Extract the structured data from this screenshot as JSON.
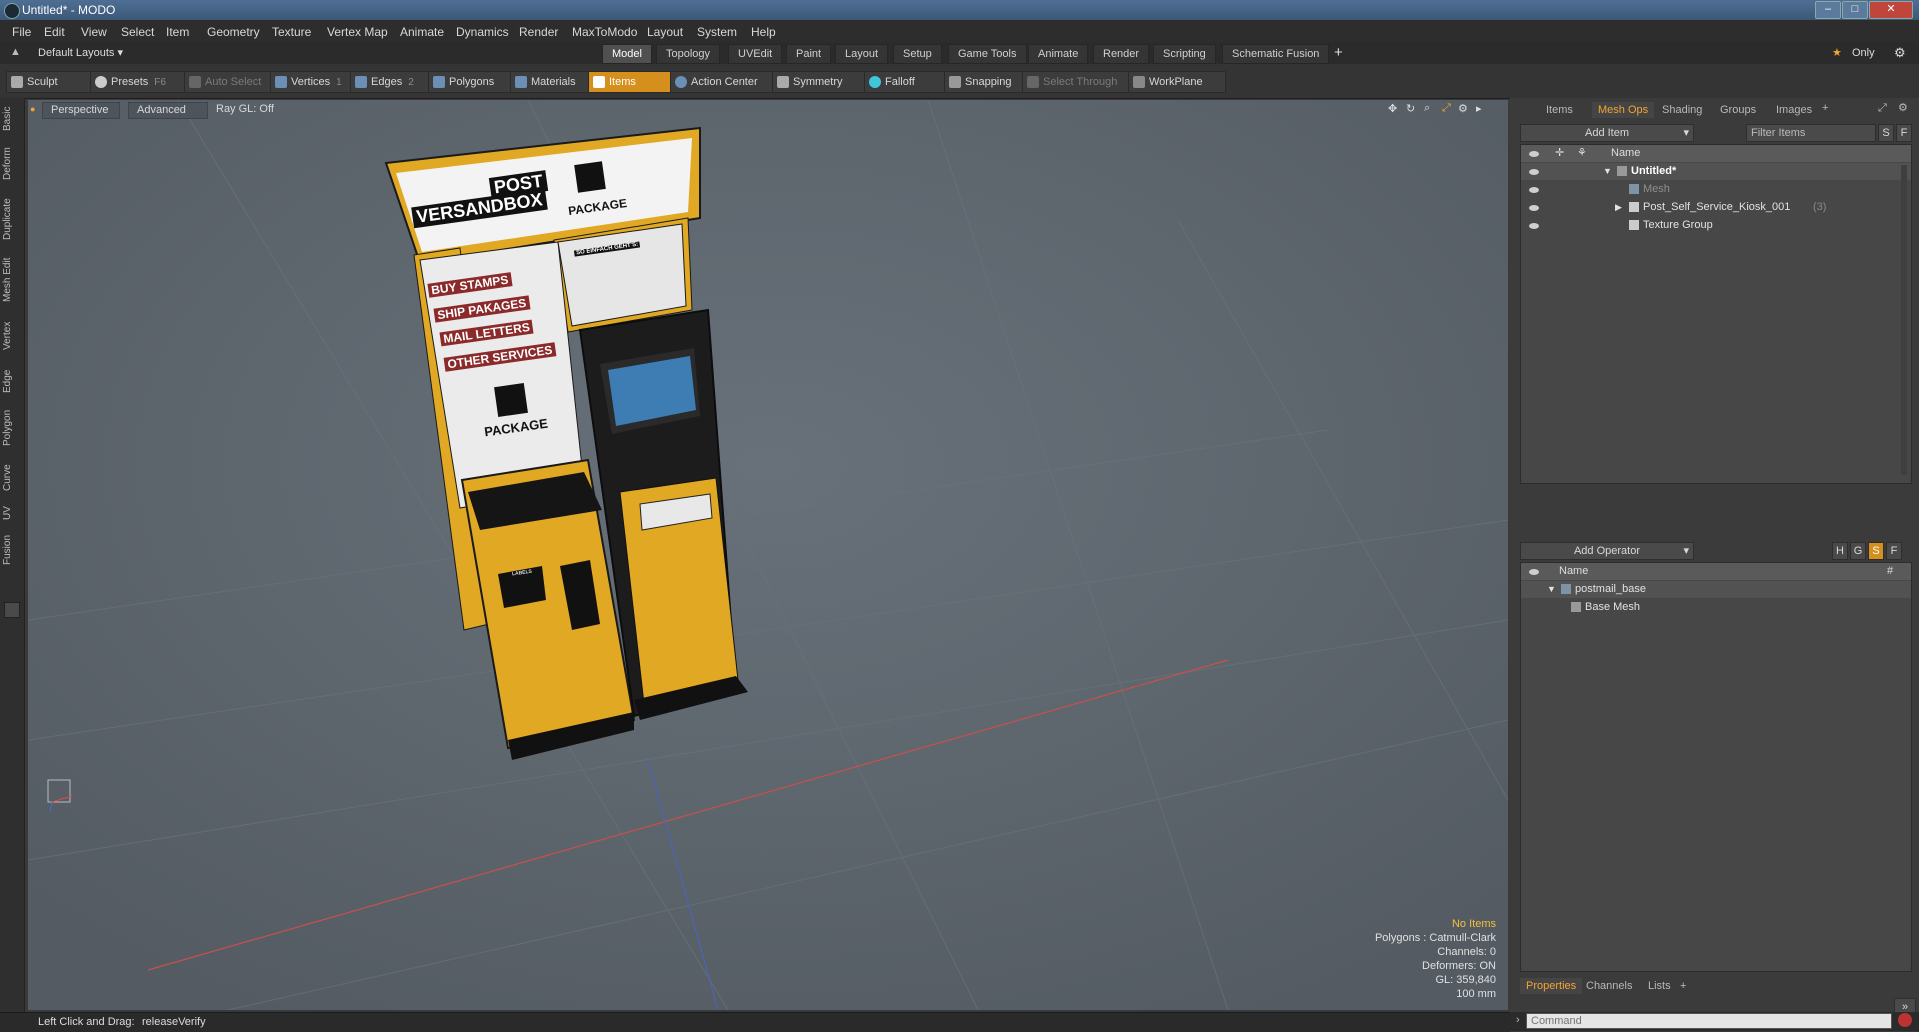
{
  "window": {
    "title": "Untitled* - MODO"
  },
  "menu": [
    "File",
    "Edit",
    "View",
    "Select",
    "Item",
    "Geometry",
    "Texture",
    "Vertex Map",
    "Animate",
    "Dynamics",
    "Render",
    "MaxToModo",
    "Layout",
    "System",
    "Help"
  ],
  "layout_bar": {
    "layouts_label": "Default Layouts",
    "tabs": [
      "Model",
      "Topology",
      "UVEdit",
      "Paint",
      "Layout",
      "Setup",
      "Game Tools",
      "Animate",
      "Render",
      "Scripting",
      "Schematic Fusion"
    ],
    "active_tab": "Model",
    "only_label": "Only"
  },
  "toolbar": {
    "sculpt": "Sculpt",
    "presets": "Presets",
    "presets_key": "F6",
    "auto_select": "Auto Select",
    "vertices": "Vertices",
    "vertices_key": "1",
    "edges": "Edges",
    "edges_key": "2",
    "polygons": "Polygons",
    "materials": "Materials",
    "items": "Items",
    "action_center": "Action Center",
    "symmetry": "Symmetry",
    "falloff": "Falloff",
    "snapping": "Snapping",
    "select_through": "Select Through",
    "workplane": "WorkPlane"
  },
  "left_tabs": [
    "Basic",
    "Deform",
    "Duplicate",
    "Mesh Edit",
    "Vertex",
    "Edge",
    "Polygon",
    "Curve",
    "UV",
    "Fusion"
  ],
  "viewport": {
    "perspective": "Perspective",
    "advanced": "Advanced",
    "raygl": "Ray GL: Off",
    "info": {
      "no_items": "No Items",
      "polygons": "Polygons : Catmull-Clark",
      "channels": "Channels: 0",
      "deformers": "Deformers: ON",
      "gl": "GL: 359,840",
      "scale": "100 mm"
    },
    "scene_text": {
      "post": "POST",
      "versandbox": "VERSANDBOX",
      "package_top": "PACKAGE",
      "buy_stamps": "BUY STAMPS",
      "ship_packages": "SHIP PAKAGES",
      "mail_letters": "MAIL LETTERS",
      "other_services": "OTHER SERVICES",
      "package_mid": "PACKAGE",
      "so_einfach": "SO EINFACH GEHT'S:",
      "labels": "LABELS"
    },
    "colors": {
      "kiosk_yellow": "#e0a823",
      "kiosk_black": "#1a1a1a",
      "viewport_bg": "#5d656c"
    }
  },
  "right_panel": {
    "tabs": [
      "Items",
      "Mesh Ops",
      "Shading",
      "Groups",
      "Images"
    ],
    "active_tab": "Mesh Ops",
    "add_item": "Add Item",
    "filter_items": "Filter Items",
    "name_col": "Name",
    "tree": [
      {
        "label": "Untitled*",
        "bold": true
      },
      {
        "label": "Mesh",
        "dim": true
      },
      {
        "label": "Post_Self_Service_Kiosk_001",
        "count": "(3)"
      },
      {
        "label": "Texture Group"
      }
    ],
    "add_operator": "Add Operator",
    "op_name_col": "Name",
    "op_hash_col": "#",
    "operators": [
      {
        "label": "postmail_base"
      },
      {
        "label": "Base Mesh"
      }
    ],
    "bottom_tabs": [
      "Properties",
      "Channels",
      "Lists"
    ],
    "bottom_active": "Properties",
    "command_placeholder": "Command",
    "accent": "#f3a531"
  },
  "status": {
    "hint_label": "Left Click and Drag:",
    "hint_value": "releaseVerify"
  }
}
